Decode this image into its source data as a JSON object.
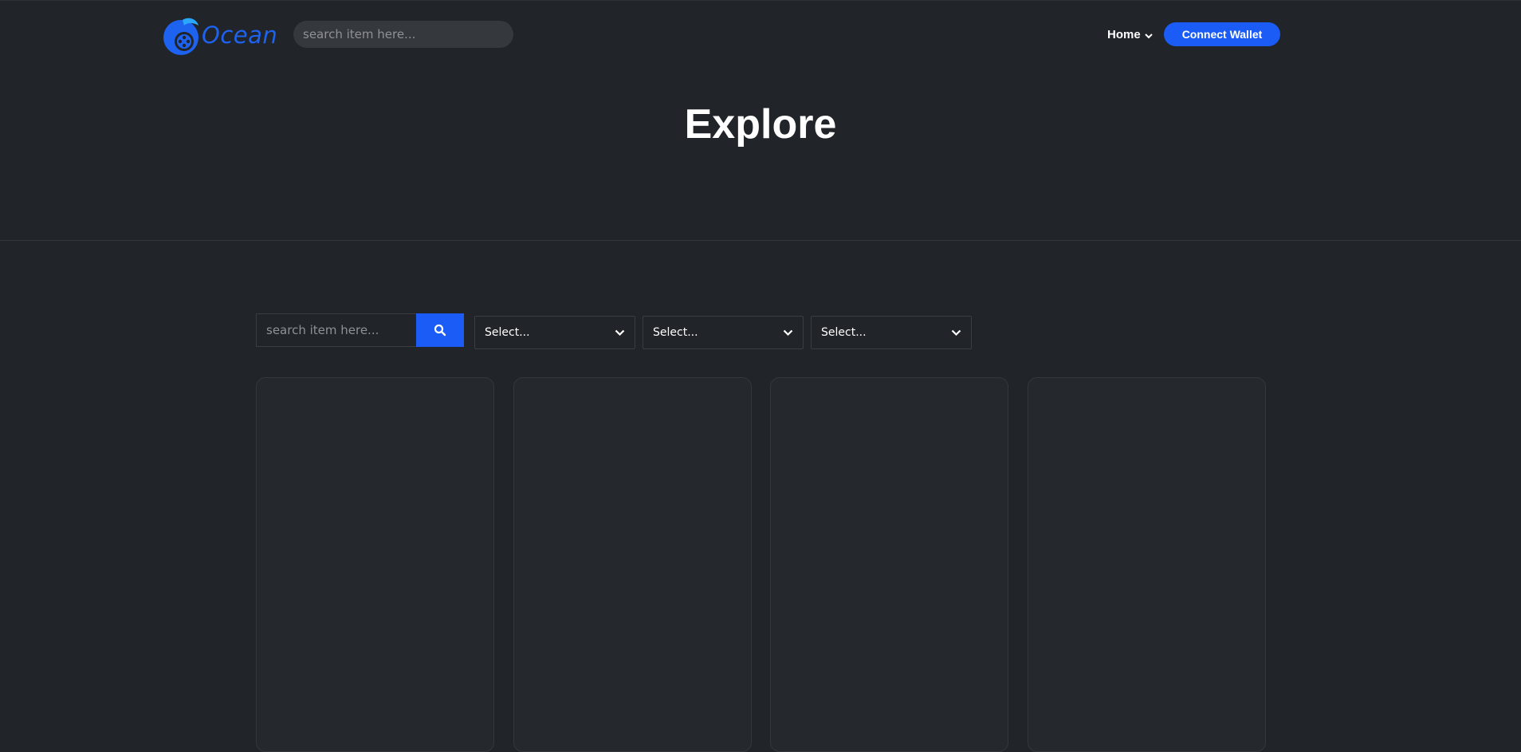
{
  "brand": {
    "name": "Ocean",
    "accent": "#1a5cf5"
  },
  "header": {
    "search_placeholder": "search item here...",
    "nav_home_label": "Home",
    "connect_wallet_label": "Connect Wallet"
  },
  "hero": {
    "title": "Explore"
  },
  "filters": {
    "search_placeholder": "search item here...",
    "search_icon": "search-icon",
    "selects": [
      {
        "value": "Select..."
      },
      {
        "value": "Select..."
      },
      {
        "value": "Select..."
      }
    ]
  },
  "cards": [
    {
      "state": "empty"
    },
    {
      "state": "empty"
    },
    {
      "state": "empty"
    },
    {
      "state": "empty"
    }
  ]
}
